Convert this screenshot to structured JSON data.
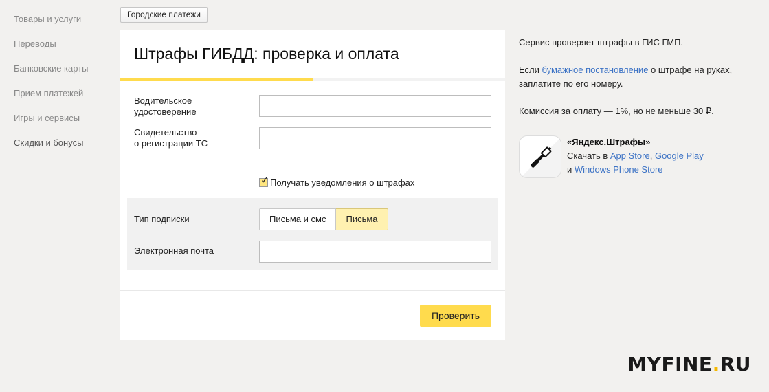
{
  "sidebar": {
    "items": [
      {
        "label": "Товары и услуги"
      },
      {
        "label": "Переводы"
      },
      {
        "label": "Банковские карты"
      },
      {
        "label": "Прием платежей"
      },
      {
        "label": "Игры и сервисы"
      },
      {
        "label": "Скидки и бонусы"
      }
    ]
  },
  "breadcrumb": {
    "label": "Городские платежи"
  },
  "form": {
    "title": "Штрафы ГИБДД: проверка и оплата",
    "progress_percent": 50,
    "license_label": "Водительское\nудостоверение",
    "license_value": "",
    "registration_label": "Свидетельство\nо регистрации ТС",
    "registration_value": "",
    "notify_label": "Получать уведомления о штрафах",
    "notify_checked": true,
    "subscription_label": "Тип подписки",
    "subscription_options": [
      "Письма и смс",
      "Письма"
    ],
    "subscription_selected": "Письма",
    "email_label": "Электронная почта",
    "email_value": "",
    "submit_label": "Проверить"
  },
  "info": {
    "line1": "Сервис проверяет штрафы в ГИС ГМП.",
    "line2_prefix": "Если ",
    "line2_link": "бумажное постановление",
    "line2_suffix": " о штрафе на руках, заплатите по его номеру.",
    "commission": "Комиссия за оплату — 1%, но не меньше 30 ₽."
  },
  "app": {
    "title": "«Яндекс.Штрафы»",
    "download_prefix": "Скачать в ",
    "store1": "App Store",
    "sep": ", ",
    "store2": "Google Play",
    "and": "и ",
    "store3": "Windows Phone Store"
  },
  "watermark": {
    "main": "MYFINE",
    "dot": ".",
    "tld": "RU"
  },
  "colors": {
    "accent": "#ffdb4d",
    "link": "#3d73c5",
    "background": "#f2f1ef"
  }
}
